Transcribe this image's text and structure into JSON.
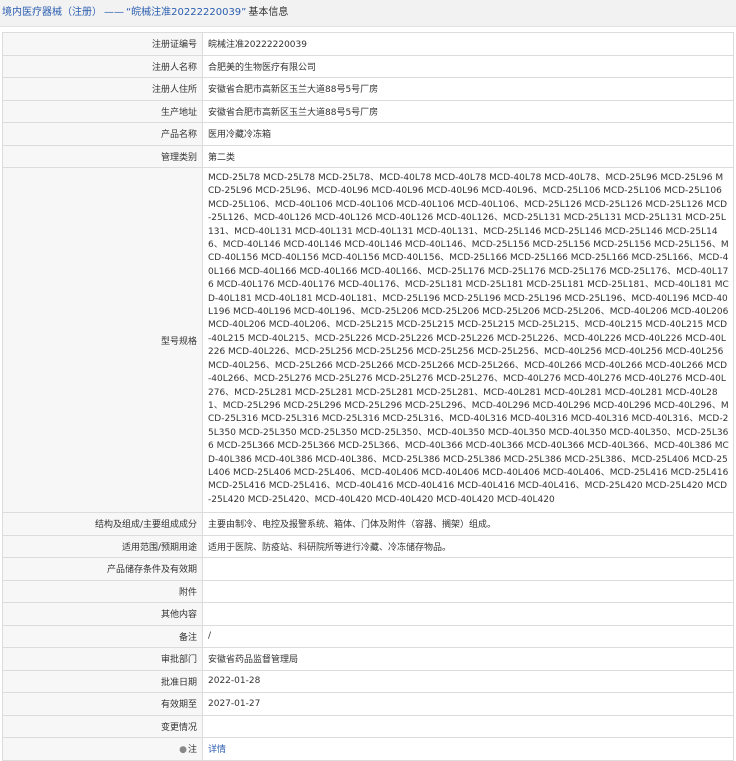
{
  "header": {
    "prefix": "境内医疗器械（注册）",
    "separator": "——",
    "quoted": "“皖械注准20222220039”",
    "suffix": "基本信息"
  },
  "fields": [
    {
      "label": "注册证编号",
      "value": "皖械注准20222220039"
    },
    {
      "label": "注册人名称",
      "value": "合肥美的生物医疗有限公司"
    },
    {
      "label": "注册人住所",
      "value": "安徽省合肥市高新区玉兰大道88号5号厂房"
    },
    {
      "label": "生产地址",
      "value": "安徽省合肥市高新区玉兰大道88号5号厂房"
    },
    {
      "label": "产品名称",
      "value": "医用冷藏冷冻箱"
    },
    {
      "label": "管理类别",
      "value": "第二类"
    },
    {
      "label": "型号规格",
      "value": "MCD-25L78 MCD-25L78 MCD-25L78、MCD-40L78 MCD-40L78 MCD-40L78 MCD-40L78、MCD-25L96 MCD-25L96 MCD-25L96 MCD-25L96、MCD-40L96 MCD-40L96 MCD-40L96 MCD-40L96、MCD-25L106 MCD-25L106 MCD-25L106 MCD-25L106、MCD-40L106 MCD-40L106 MCD-40L106 MCD-40L106、MCD-25L126 MCD-25L126 MCD-25L126 MCD-25L126、MCD-40L126 MCD-40L126 MCD-40L126 MCD-40L126、MCD-25L131 MCD-25L131 MCD-25L131 MCD-25L131、MCD-40L131 MCD-40L131 MCD-40L131 MCD-40L131、MCD-25L146 MCD-25L146 MCD-25L146 MCD-25L146、MCD-40L146 MCD-40L146 MCD-40L146 MCD-40L146、MCD-25L156 MCD-25L156 MCD-25L156 MCD-25L156、MCD-40L156 MCD-40L156 MCD-40L156 MCD-40L156、MCD-25L166 MCD-25L166 MCD-25L166 MCD-25L166、MCD-40L166 MCD-40L166 MCD-40L166 MCD-40L166、MCD-25L176 MCD-25L176 MCD-25L176 MCD-25L176、MCD-40L176 MCD-40L176 MCD-40L176 MCD-40L176、MCD-25L181 MCD-25L181 MCD-25L181 MCD-25L181、MCD-40L181 MCD-40L181 MCD-40L181 MCD-40L181、MCD-25L196 MCD-25L196 MCD-25L196 MCD-25L196、MCD-40L196 MCD-40L196 MCD-40L196 MCD-40L196、MCD-25L206 MCD-25L206 MCD-25L206 MCD-25L206、MCD-40L206 MCD-40L206 MCD-40L206 MCD-40L206、MCD-25L215 MCD-25L215 MCD-25L215 MCD-25L215、MCD-40L215 MCD-40L215 MCD-40L215 MCD-40L215、MCD-25L226 MCD-25L226 MCD-25L226 MCD-25L226、MCD-40L226 MCD-40L226 MCD-40L226 MCD-40L226、MCD-25L256 MCD-25L256 MCD-25L256 MCD-25L256、MCD-40L256 MCD-40L256 MCD-40L256 MCD-40L256、MCD-25L266 MCD-25L266 MCD-25L266 MCD-25L266、MCD-40L266 MCD-40L266 MCD-40L266 MCD-40L266、MCD-25L276 MCD-25L276 MCD-25L276 MCD-25L276、MCD-40L276 MCD-40L276 MCD-40L276 MCD-40L276、MCD-25L281 MCD-25L281 MCD-25L281 MCD-25L281、MCD-40L281 MCD-40L281 MCD-40L281 MCD-40L281、MCD-25L296 MCD-25L296 MCD-25L296 MCD-25L296、MCD-40L296 MCD-40L296 MCD-40L296 MCD-40L296、MCD-25L316 MCD-25L316 MCD-25L316 MCD-25L316、MCD-40L316 MCD-40L316 MCD-40L316 MCD-40L316、MCD-25L350 MCD-25L350 MCD-25L350 MCD-25L350、MCD-40L350 MCD-40L350 MCD-40L350 MCD-40L350、MCD-25L366 MCD-25L366 MCD-25L366 MCD-25L366、MCD-40L366 MCD-40L366 MCD-40L366 MCD-40L366、MCD-40L386 MCD-40L386 MCD-40L386 MCD-40L386、MCD-25L386 MCD-25L386 MCD-25L386 MCD-25L386、MCD-25L406 MCD-25L406 MCD-25L406 MCD-25L406、MCD-40L406 MCD-40L406 MCD-40L406 MCD-40L406、MCD-25L416 MCD-25L416 MCD-25L416 MCD-25L416、MCD-40L416 MCD-40L416 MCD-40L416 MCD-40L416、MCD-25L420 MCD-25L420 MCD-25L420 MCD-25L420、MCD-40L420 MCD-40L420 MCD-40L420 MCD-40L420"
    },
    {
      "label": "结构及组成/主要组成成分",
      "value": "主要由制冷、电控及报警系统、箱体、门体及附件（容器、搁架）组成。"
    },
    {
      "label": "适用范围/预期用途",
      "value": "适用于医院、防疫站、科研院所等进行冷藏、冷冻储存物品。"
    },
    {
      "label": "产品储存条件及有效期",
      "value": ""
    },
    {
      "label": "附件",
      "value": ""
    },
    {
      "label": "其他内容",
      "value": ""
    },
    {
      "label": "备注",
      "value": "/"
    },
    {
      "label": "审批部门",
      "value": "安徽省药品监督管理局"
    },
    {
      "label": "批准日期",
      "value": "2022-01-28"
    },
    {
      "label": "有效期至",
      "value": "2027-01-27"
    },
    {
      "label": "变更情况",
      "value": ""
    }
  ],
  "note_row": {
    "label": "注",
    "link": "详情",
    "icon": "lightbulb-icon"
  }
}
